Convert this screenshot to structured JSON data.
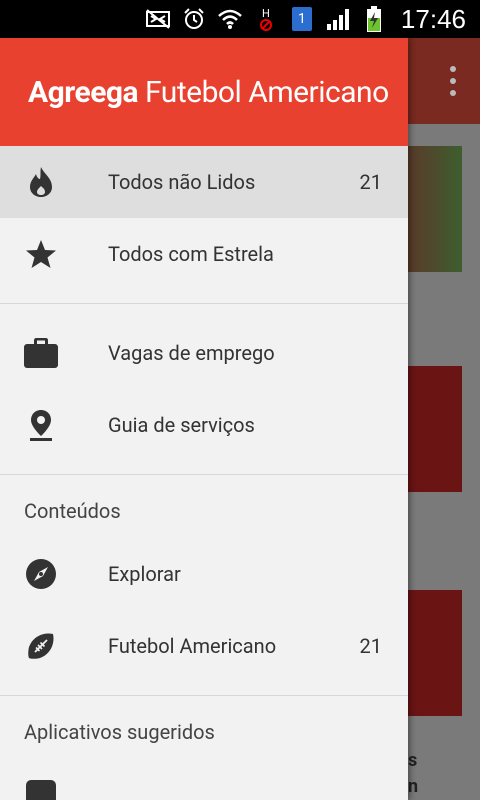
{
  "status_bar": {
    "time": "17:46",
    "sim_badge": "1",
    "network_letter": "H",
    "icons": [
      "nfc-off-icon",
      "alarm-icon",
      "wifi-icon",
      "network-h-icon",
      "sim-icon",
      "signal-icon",
      "battery-charging-icon"
    ]
  },
  "drawer": {
    "title_bold": "Agreega",
    "title_rest": " Futebol Americano",
    "header_color": "#e94130",
    "primary_items": [
      {
        "label": "Todos não Lidos",
        "count": "21",
        "icon": "flame-icon"
      },
      {
        "label": "Todos com Estrela",
        "count": "",
        "icon": "star-icon"
      }
    ],
    "secondary_items": [
      {
        "label": "Vagas de emprego",
        "icon": "briefcase-icon"
      },
      {
        "label": "Guia de serviços",
        "icon": "location-pin-icon"
      }
    ],
    "content_section": {
      "header": "Conteúdos",
      "items": [
        {
          "label": "Explorar",
          "count": "",
          "icon": "compass-icon"
        },
        {
          "label": "Futebol Americano",
          "count": "21",
          "icon": "football-icon"
        }
      ]
    },
    "apps_section": {
      "header": "Aplicativos sugeridos"
    }
  },
  "background": {
    "text_s": "s",
    "text_n": "n"
  }
}
